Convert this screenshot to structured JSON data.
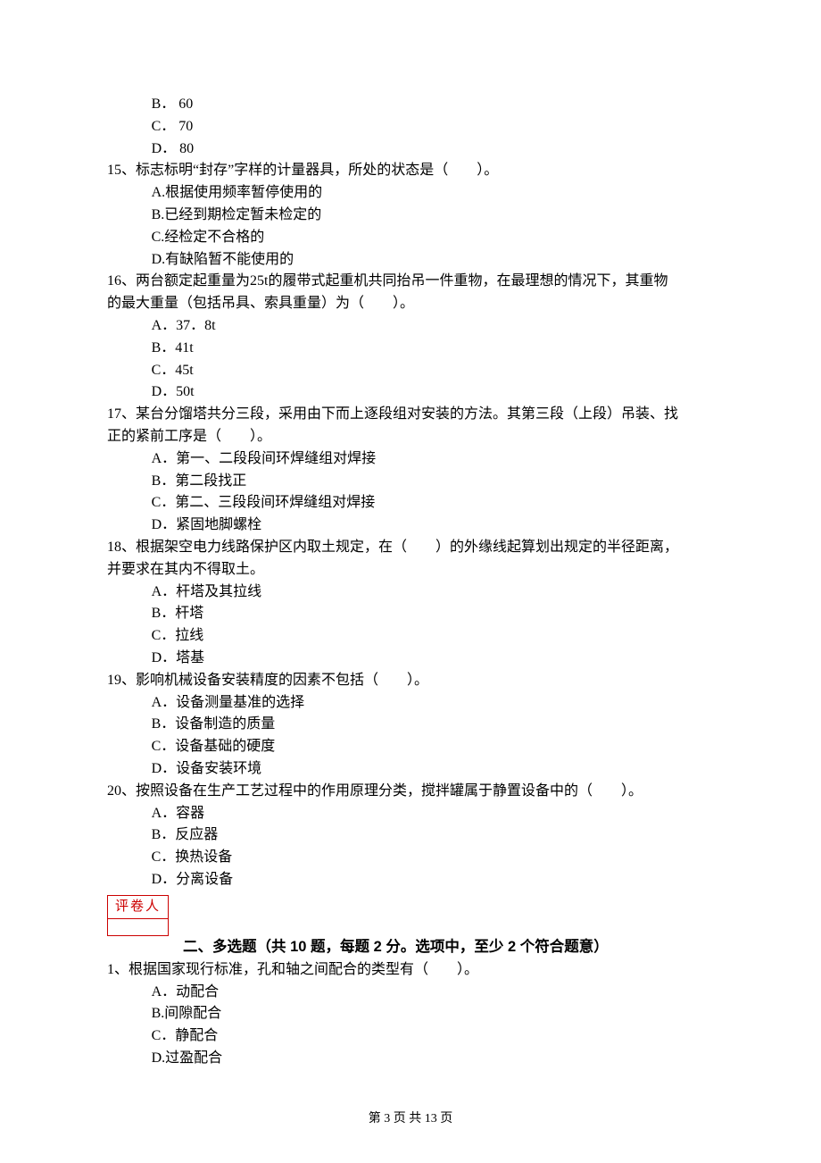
{
  "options_run": [
    {
      "letter": "B",
      "text": "60",
      "sep": "．"
    },
    {
      "letter": "C",
      "text": "70",
      "sep": "．"
    },
    {
      "letter": "D",
      "text": "80",
      "sep": "．"
    }
  ],
  "questions": [
    {
      "num": "15",
      "stem_lines": [
        "标志标明“封存”字样的计量器具，所处的状态是（　　）。"
      ],
      "options": [
        {
          "letter": "A",
          "text": "根据使用频率暂停使用的",
          "sep": "."
        },
        {
          "letter": "B",
          "text": "已经到期检定暂未检定的",
          "sep": "."
        },
        {
          "letter": "C",
          "text": "经检定不合格的",
          "sep": "."
        },
        {
          "letter": "D",
          "text": "有缺陷暂不能使用的",
          "sep": "."
        }
      ]
    },
    {
      "num": "16",
      "stem_lines": [
        "两台额定起重量为25t的履带式起重机共同抬吊一件重物，在最理想的情况下，其重物",
        "的最大重量（包括吊具、索具重量）为（　　）。"
      ],
      "options": [
        {
          "letter": "A",
          "text": "37．8t",
          "sep": "．"
        },
        {
          "letter": "B",
          "text": "41t",
          "sep": "．"
        },
        {
          "letter": "C",
          "text": "45t",
          "sep": "．"
        },
        {
          "letter": "D",
          "text": "50t",
          "sep": "．"
        }
      ]
    },
    {
      "num": "17",
      "stem_lines": [
        "某台分馏塔共分三段，采用由下而上逐段组对安装的方法。其第三段（上段）吊装、找",
        "正的紧前工序是（　　）。"
      ],
      "options": [
        {
          "letter": "A",
          "text": "第一、二段段间环焊缝组对焊接",
          "sep": "．"
        },
        {
          "letter": "B",
          "text": "第二段找正",
          "sep": "．"
        },
        {
          "letter": "C",
          "text": "第二、三段段间环焊缝组对焊接",
          "sep": "．"
        },
        {
          "letter": "D",
          "text": "紧固地脚螺栓",
          "sep": "．"
        }
      ]
    },
    {
      "num": "18",
      "stem_lines": [
        "根据架空电力线路保护区内取土规定，在（　　）的外缘线起算划出规定的半径距离，",
        "并要求在其内不得取土。"
      ],
      "options": [
        {
          "letter": "A",
          "text": "杆塔及其拉线",
          "sep": "．"
        },
        {
          "letter": "B",
          "text": "杆塔",
          "sep": "．"
        },
        {
          "letter": "C",
          "text": "拉线",
          "sep": "．"
        },
        {
          "letter": "D",
          "text": "塔基",
          "sep": "．"
        }
      ]
    },
    {
      "num": "19",
      "stem_lines": [
        "影响机械设备安装精度的因素不包括（　　）。"
      ],
      "options": [
        {
          "letter": "A",
          "text": "设备测量基准的选择",
          "sep": "．"
        },
        {
          "letter": "B",
          "text": "设备制造的质量",
          "sep": "．"
        },
        {
          "letter": "C",
          "text": "设备基础的硬度",
          "sep": "．"
        },
        {
          "letter": "D",
          "text": "设备安装环境",
          "sep": "．"
        }
      ]
    },
    {
      "num": "20",
      "stem_lines": [
        "按照设备在生产工艺过程中的作用原理分类，搅拌罐属于静置设备中的（　　）。"
      ],
      "options": [
        {
          "letter": "A",
          "text": "容器",
          "sep": "．"
        },
        {
          "letter": "B",
          "text": "反应器",
          "sep": "．"
        },
        {
          "letter": "C",
          "text": "换热设备",
          "sep": "．"
        },
        {
          "letter": "D",
          "text": "分离设备",
          "sep": "．"
        }
      ]
    }
  ],
  "grader_label": "评卷人",
  "section2_title": "二、多选题（共 10 题，每题 2 分。选项中，至少 2 个符合题意）",
  "mcq": [
    {
      "num": "1",
      "stem_lines": [
        "根据国家现行标准，孔和轴之间配合的类型有（　　）。"
      ],
      "options": [
        {
          "letter": "A",
          "text": "动配合",
          "sep": "．"
        },
        {
          "letter": "B",
          "text": "间隙配合",
          "sep": "."
        },
        {
          "letter": "C",
          "text": "静配合",
          "sep": "．"
        },
        {
          "letter": "D",
          "text": "过盈配合",
          "sep": "."
        }
      ]
    }
  ],
  "footer": "第 3 页 共 13 页"
}
